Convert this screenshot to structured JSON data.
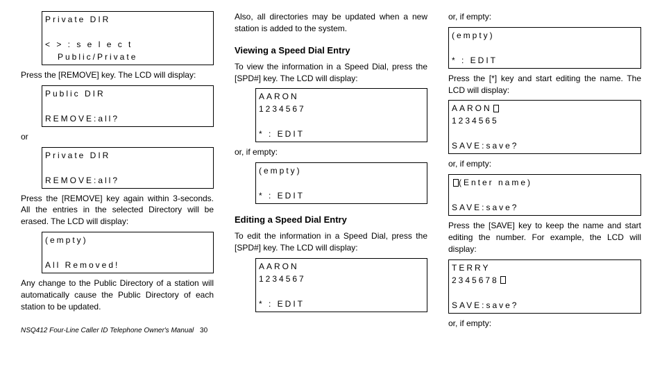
{
  "col1": {
    "lcd1": {
      "l1": "Private DIR",
      "l2": "< > : s e l e c t",
      "l3": "Public/Private"
    },
    "p1": "Press the [REMOVE] key. The LCD will display:",
    "lcd2": {
      "l1": "Public DIR",
      "l3": "REMOVE:all?"
    },
    "p2": "or",
    "lcd3": {
      "l1": "Private DIR",
      "l3": "REMOVE:all?"
    },
    "p3": "Press the [REMOVE] key again within 3-seconds. All the entries in the selected Directory will be erased. The LCD will display:",
    "lcd4": {
      "l1": "(empty)",
      "l3": "All Removed!"
    },
    "p4": "Any change to the Public Directory of a station will automatically cause the Public Directory of each station to be updated."
  },
  "col2": {
    "p1": "Also, all directories may be updated when a new station is added to the system.",
    "h1": "Viewing a Speed Dial Entry",
    "p2": "To view the information in a Speed Dial, press the [SPD#] key. The LCD will display:",
    "lcd1": {
      "l1": "AARON",
      "l2": "1234567",
      "l4": "* : EDIT"
    },
    "p3": "or, if empty:",
    "lcd2": {
      "l1": "(empty)",
      "l3": "* : EDIT"
    },
    "h2": "Editing a Speed Dial Entry",
    "p4": "To edit the information in a Speed Dial, press the [SPD#] key. The LCD will display:",
    "lcd3": {
      "l1": "AARON",
      "l2": "1234567",
      "l4": "* : EDIT"
    }
  },
  "col3": {
    "p1": "or, if empty:",
    "lcd1": {
      "l1": "(empty)",
      "l3": "* : EDIT"
    },
    "p2": "Press the [*] key and start editing the name. The LCD will display:",
    "lcd2": {
      "l1": "AARON",
      "l2": "1234565",
      "l4": "SAVE:save?"
    },
    "p3": "or, if empty:",
    "lcd3": {
      "l1": "(Enter name)",
      "l3": "SAVE:save?"
    },
    "p4": "Press the [SAVE] key to keep the name and start editing the number. For example, the LCD will display:",
    "lcd4": {
      "l1": "TERRY",
      "l2": "2345678",
      "l4": "SAVE:save?"
    },
    "p5": "or, if empty:"
  },
  "footer": {
    "title": "NSQ412 Four-Line Caller ID Telephone Owner's Manual",
    "page": "30"
  }
}
